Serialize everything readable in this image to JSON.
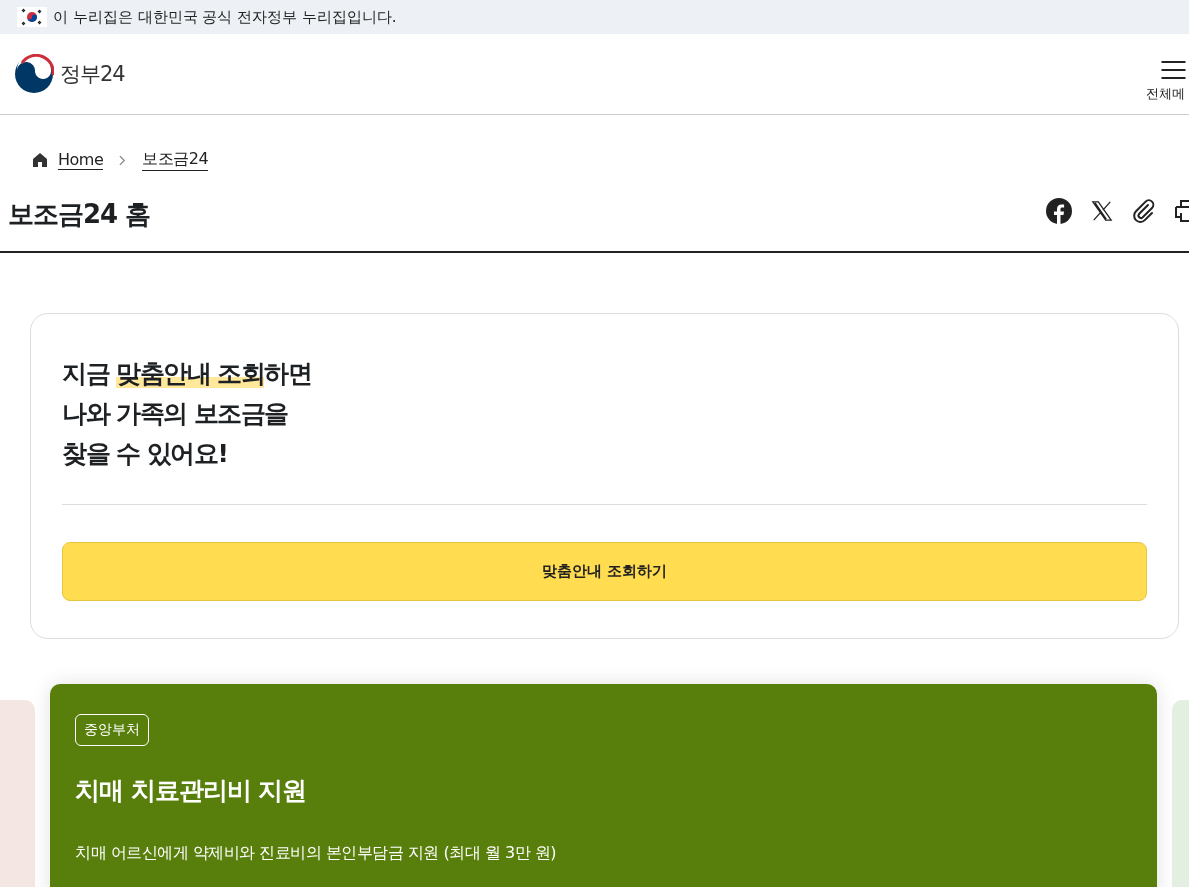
{
  "gov_banner": {
    "text": "이 누리집은 대한민국 공식 전자정부 누리집입니다."
  },
  "header": {
    "logo_text": "정부24",
    "menu_label": "전체메"
  },
  "breadcrumb": [
    {
      "label": "Home",
      "kind": "home"
    },
    {
      "label": "보조금24",
      "kind": "page"
    }
  ],
  "page_title": "보조금24 홈",
  "share_icons": [
    {
      "kind": "facebook"
    },
    {
      "kind": "x"
    },
    {
      "kind": "link"
    },
    {
      "kind": "print"
    }
  ],
  "promo": {
    "headline_lines": [
      [
        {
          "text": "지금 ",
          "highlighted": false
        },
        {
          "text": "맞춤안내 조회",
          "highlighted": true
        },
        {
          "text": "하면",
          "highlighted": false
        }
      ],
      [
        {
          "text": "나와 가족의 보조금을",
          "highlighted": false
        }
      ],
      [
        {
          "text": "찾을 수 있어요!",
          "highlighted": false
        }
      ]
    ],
    "button": "맞춤안내 조회하기"
  },
  "carousel": [
    {
      "color": "#f4e6e3",
      "selected": false
    },
    {
      "color": "#587f0b",
      "selected": true,
      "tag": "중앙부처",
      "title": "치매 치료관리비 지원",
      "description": "치매 어르신에게 약제비와 진료비의 본인부담금 지원 (최대 월 3만 원)"
    },
    {
      "color": "#e3efe1",
      "selected": false
    }
  ]
}
